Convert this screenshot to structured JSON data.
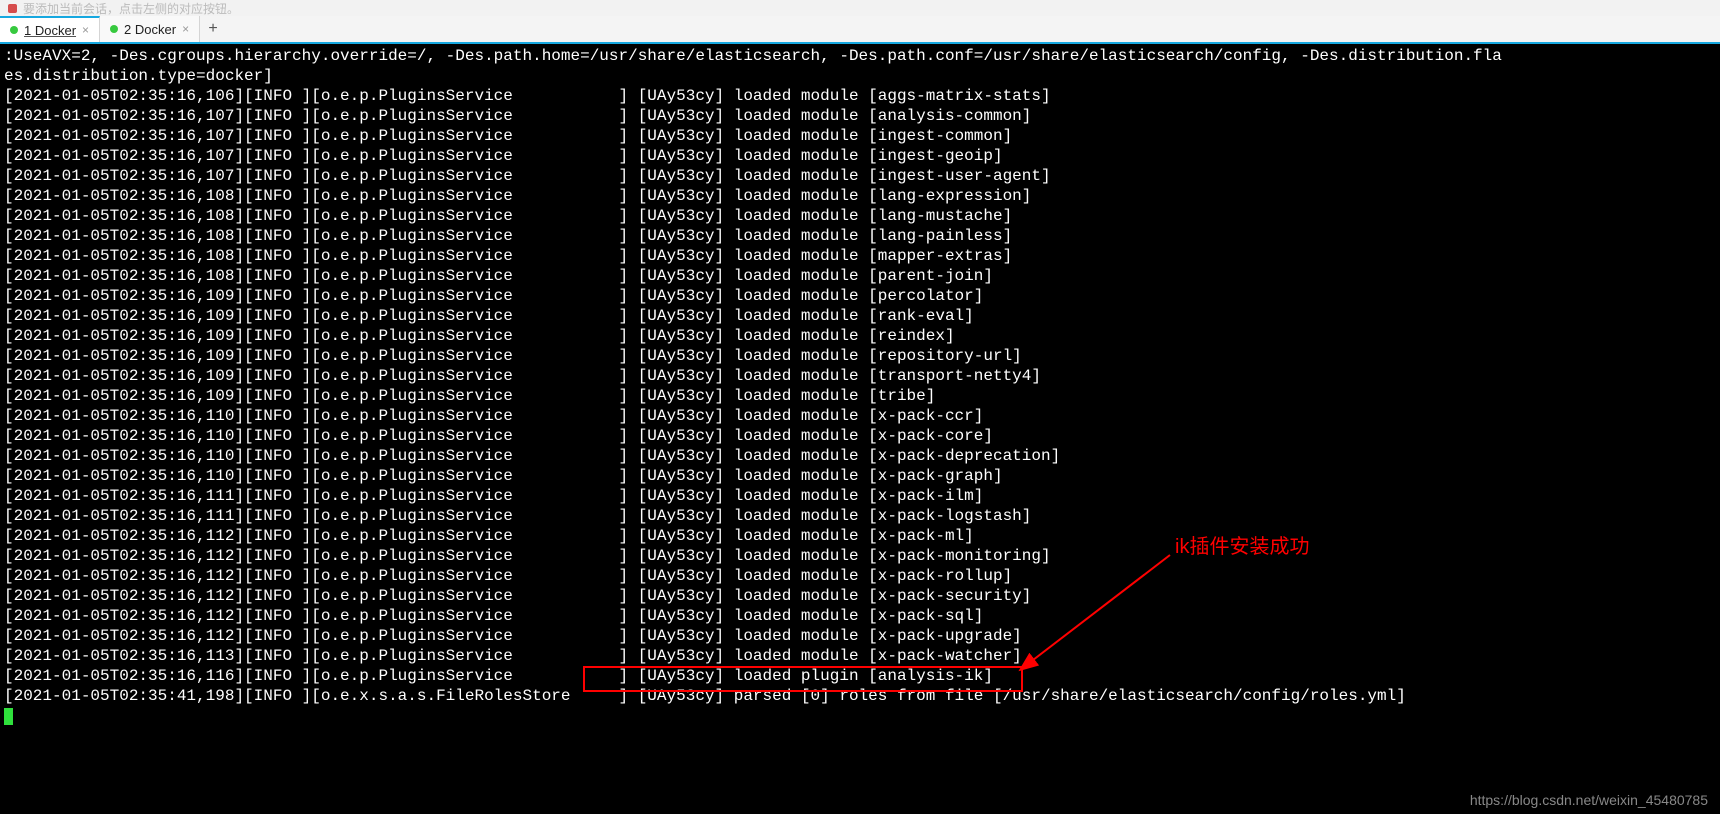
{
  "top_hint": "要添加当前会话，点击左侧的对应按钮。",
  "tabs": [
    {
      "label": "1 Docker",
      "active": true
    },
    {
      "label": "2 Docker",
      "active": false
    }
  ],
  "header_line": ":UseAVX=2, -Des.cgroups.hierarchy.override=/, -Des.path.home=/usr/share/elasticsearch, -Des.path.conf=/usr/share/elasticsearch/config, -Des.distribution.fla",
  "header_line2": "es.distribution.type=docker]",
  "log_prefix_component": "o.e.p.PluginsService",
  "node_name": "UAy53cy",
  "logs": [
    {
      "ts": "2021-01-05T02:35:16,106",
      "lvl": "INFO",
      "comp": "o.e.p.PluginsService",
      "msg": "loaded module [aggs-matrix-stats]"
    },
    {
      "ts": "2021-01-05T02:35:16,107",
      "lvl": "INFO",
      "comp": "o.e.p.PluginsService",
      "msg": "loaded module [analysis-common]"
    },
    {
      "ts": "2021-01-05T02:35:16,107",
      "lvl": "INFO",
      "comp": "o.e.p.PluginsService",
      "msg": "loaded module [ingest-common]"
    },
    {
      "ts": "2021-01-05T02:35:16,107",
      "lvl": "INFO",
      "comp": "o.e.p.PluginsService",
      "msg": "loaded module [ingest-geoip]"
    },
    {
      "ts": "2021-01-05T02:35:16,107",
      "lvl": "INFO",
      "comp": "o.e.p.PluginsService",
      "msg": "loaded module [ingest-user-agent]"
    },
    {
      "ts": "2021-01-05T02:35:16,108",
      "lvl": "INFO",
      "comp": "o.e.p.PluginsService",
      "msg": "loaded module [lang-expression]"
    },
    {
      "ts": "2021-01-05T02:35:16,108",
      "lvl": "INFO",
      "comp": "o.e.p.PluginsService",
      "msg": "loaded module [lang-mustache]"
    },
    {
      "ts": "2021-01-05T02:35:16,108",
      "lvl": "INFO",
      "comp": "o.e.p.PluginsService",
      "msg": "loaded module [lang-painless]"
    },
    {
      "ts": "2021-01-05T02:35:16,108",
      "lvl": "INFO",
      "comp": "o.e.p.PluginsService",
      "msg": "loaded module [mapper-extras]"
    },
    {
      "ts": "2021-01-05T02:35:16,108",
      "lvl": "INFO",
      "comp": "o.e.p.PluginsService",
      "msg": "loaded module [parent-join]"
    },
    {
      "ts": "2021-01-05T02:35:16,109",
      "lvl": "INFO",
      "comp": "o.e.p.PluginsService",
      "msg": "loaded module [percolator]"
    },
    {
      "ts": "2021-01-05T02:35:16,109",
      "lvl": "INFO",
      "comp": "o.e.p.PluginsService",
      "msg": "loaded module [rank-eval]"
    },
    {
      "ts": "2021-01-05T02:35:16,109",
      "lvl": "INFO",
      "comp": "o.e.p.PluginsService",
      "msg": "loaded module [reindex]"
    },
    {
      "ts": "2021-01-05T02:35:16,109",
      "lvl": "INFO",
      "comp": "o.e.p.PluginsService",
      "msg": "loaded module [repository-url]"
    },
    {
      "ts": "2021-01-05T02:35:16,109",
      "lvl": "INFO",
      "comp": "o.e.p.PluginsService",
      "msg": "loaded module [transport-netty4]"
    },
    {
      "ts": "2021-01-05T02:35:16,109",
      "lvl": "INFO",
      "comp": "o.e.p.PluginsService",
      "msg": "loaded module [tribe]"
    },
    {
      "ts": "2021-01-05T02:35:16,110",
      "lvl": "INFO",
      "comp": "o.e.p.PluginsService",
      "msg": "loaded module [x-pack-ccr]"
    },
    {
      "ts": "2021-01-05T02:35:16,110",
      "lvl": "INFO",
      "comp": "o.e.p.PluginsService",
      "msg": "loaded module [x-pack-core]"
    },
    {
      "ts": "2021-01-05T02:35:16,110",
      "lvl": "INFO",
      "comp": "o.e.p.PluginsService",
      "msg": "loaded module [x-pack-deprecation]"
    },
    {
      "ts": "2021-01-05T02:35:16,110",
      "lvl": "INFO",
      "comp": "o.e.p.PluginsService",
      "msg": "loaded module [x-pack-graph]"
    },
    {
      "ts": "2021-01-05T02:35:16,111",
      "lvl": "INFO",
      "comp": "o.e.p.PluginsService",
      "msg": "loaded module [x-pack-ilm]"
    },
    {
      "ts": "2021-01-05T02:35:16,111",
      "lvl": "INFO",
      "comp": "o.e.p.PluginsService",
      "msg": "loaded module [x-pack-logstash]"
    },
    {
      "ts": "2021-01-05T02:35:16,112",
      "lvl": "INFO",
      "comp": "o.e.p.PluginsService",
      "msg": "loaded module [x-pack-ml]"
    },
    {
      "ts": "2021-01-05T02:35:16,112",
      "lvl": "INFO",
      "comp": "o.e.p.PluginsService",
      "msg": "loaded module [x-pack-monitoring]"
    },
    {
      "ts": "2021-01-05T02:35:16,112",
      "lvl": "INFO",
      "comp": "o.e.p.PluginsService",
      "msg": "loaded module [x-pack-rollup]"
    },
    {
      "ts": "2021-01-05T02:35:16,112",
      "lvl": "INFO",
      "comp": "o.e.p.PluginsService",
      "msg": "loaded module [x-pack-security]"
    },
    {
      "ts": "2021-01-05T02:35:16,112",
      "lvl": "INFO",
      "comp": "o.e.p.PluginsService",
      "msg": "loaded module [x-pack-sql]"
    },
    {
      "ts": "2021-01-05T02:35:16,112",
      "lvl": "INFO",
      "comp": "o.e.p.PluginsService",
      "msg": "loaded module [x-pack-upgrade]"
    },
    {
      "ts": "2021-01-05T02:35:16,113",
      "lvl": "INFO",
      "comp": "o.e.p.PluginsService",
      "msg": "loaded module [x-pack-watcher]"
    },
    {
      "ts": "2021-01-05T02:35:16,116",
      "lvl": "INFO",
      "comp": "o.e.p.PluginsService",
      "msg": "loaded plugin [analysis-ik]"
    },
    {
      "ts": "2021-01-05T02:35:41,198",
      "lvl": "INFO",
      "comp": "o.e.x.s.a.s.FileRolesStore",
      "msg": "parsed [0] roles from file [/usr/share/elasticsearch/config/roles.yml]"
    }
  ],
  "annotation_text": "ik插件安装成功",
  "watermark": "https://blog.csdn.net/weixin_45480785"
}
